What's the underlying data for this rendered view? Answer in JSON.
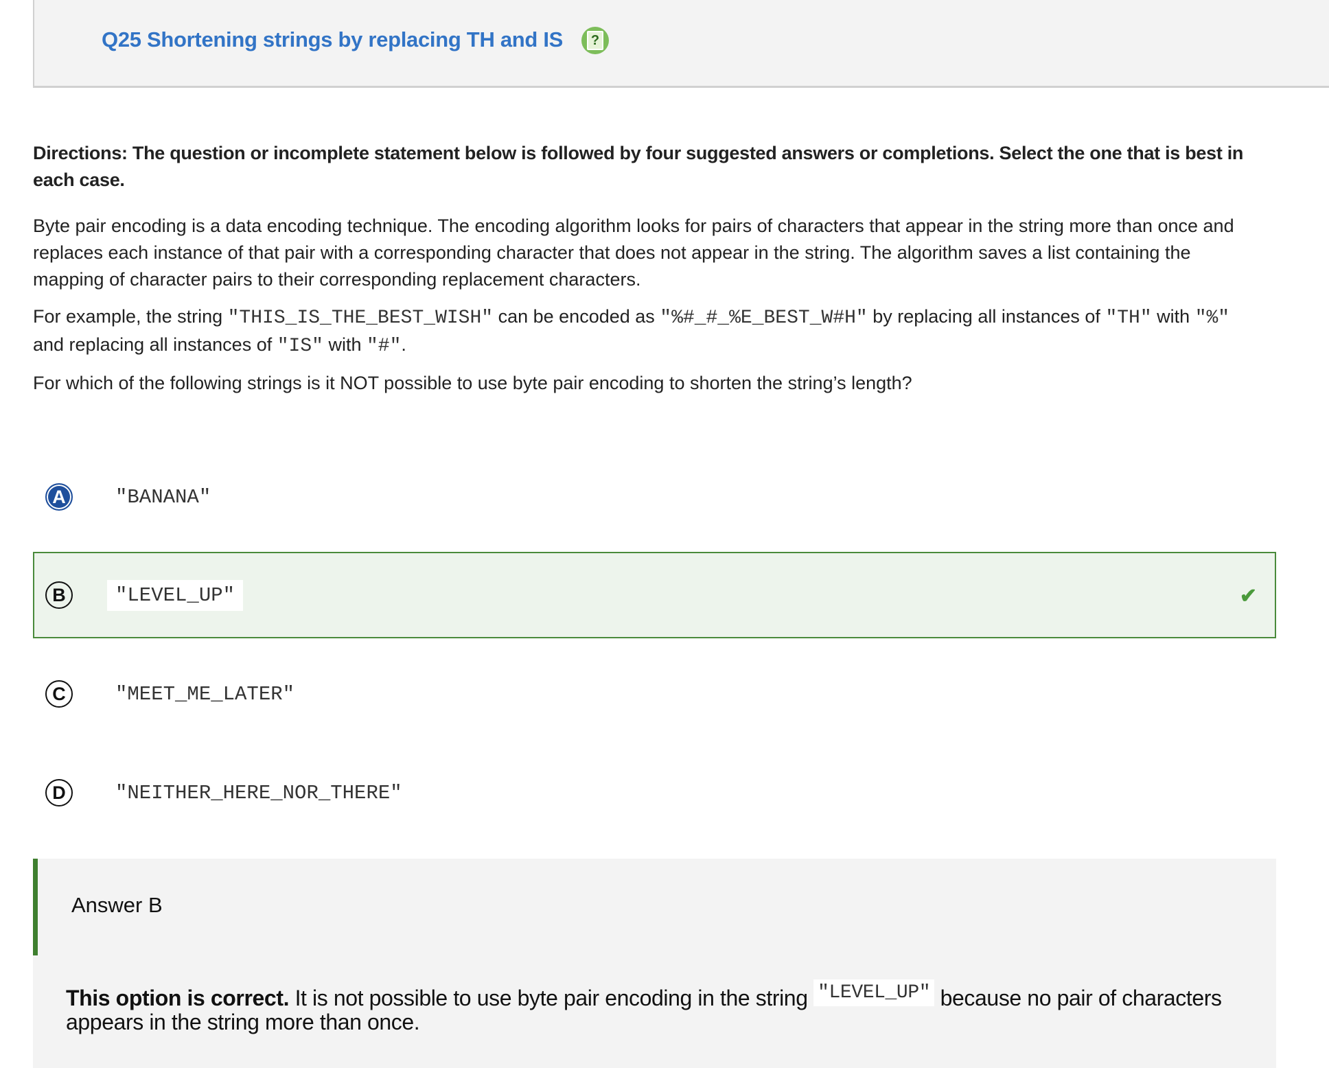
{
  "header": {
    "title": "Q25 Shortening strings by replacing TH and IS",
    "icon": "question-notepad-icon"
  },
  "directions": "Directions: The question or incomplete statement below is followed by four suggested answers or completions. Select the one that is best in each case.",
  "intro": "Byte pair encoding is a data encoding technique. The encoding algorithm looks for pairs of characters that appear in the string more than once and replaces each instance of that pair with a corresponding character that does not appear in the string. The algorithm saves a list containing the mapping of character pairs to their corresponding replacement characters.",
  "example": {
    "t1": "For example, the string ",
    "s1": "\"THIS_IS_THE_BEST_WISH\"",
    "t2": " can be encoded as ",
    "s2": "\"%#_#_%E_BEST_W#H\"",
    "t3": " by replacing all instances of ",
    "s3": "\"TH\"",
    "t4": " with ",
    "s4": "\"%\"",
    "t5": " and replacing all instances of ",
    "s5": "\"IS\"",
    "t6": " with ",
    "s6": "\"#\"",
    "t7": "."
  },
  "question": "For which of the following strings is it NOT possible to use byte pair encoding to shorten the string’s length?",
  "options": [
    {
      "letter": "A",
      "text": "\"BANANA\"",
      "selected": true
    },
    {
      "letter": "B",
      "text": "\"LEVEL_UP\"",
      "correct": true
    },
    {
      "letter": "C",
      "text": "\"MEET_ME_LATER\""
    },
    {
      "letter": "D",
      "text": "\"NEITHER_HERE_NOR_THERE\""
    }
  ],
  "answer": {
    "title": "Answer B",
    "bold": "This option is correct.",
    "t1": " It is not possible to use byte pair encoding in the string ",
    "code": "\"LEVEL_UP\"",
    "t2": " because no pair of characters appears in the string more than once."
  },
  "colors": {
    "title": "#3274c6",
    "correct": "#4a8a3b",
    "selected": "#1f4f9c"
  }
}
